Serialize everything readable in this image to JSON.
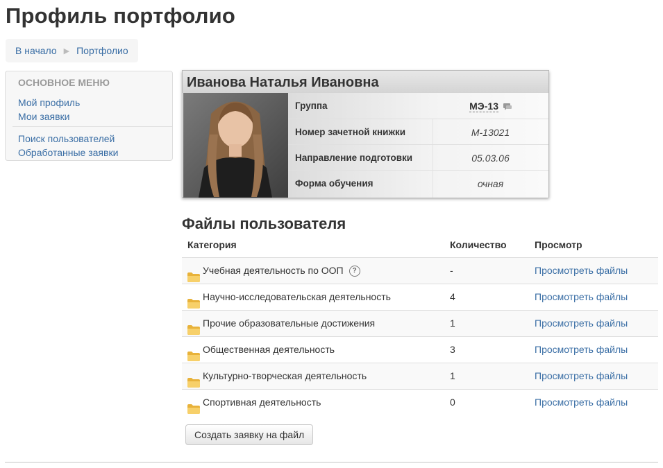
{
  "page": {
    "title": "Профиль портфолио"
  },
  "breadcrumb": {
    "items": [
      "В начало",
      "Портфолио"
    ]
  },
  "sidebar": {
    "heading": "ОСНОВНОЕ МЕНЮ",
    "links": [
      "Мой профиль",
      "Мои заявки",
      "Поиск пользователей",
      "Обработанные заявки"
    ]
  },
  "profile": {
    "name": "Иванова Наталья Ивановна",
    "fields": [
      {
        "label": "Группа",
        "value": "МЭ-13"
      },
      {
        "label": "Номер зачетной книжки",
        "value": "М-13021"
      },
      {
        "label": "Направление подготовки",
        "value": "05.03.06"
      },
      {
        "label": "Форма обучения",
        "value": "очная"
      }
    ]
  },
  "files": {
    "title": "Файлы пользователя",
    "headers": {
      "category": "Категория",
      "count": "Количество",
      "view": "Просмотр"
    },
    "rows": [
      {
        "category": "Учебная деятельность по ООП",
        "count": "-",
        "view": "Просмотреть файлы"
      },
      {
        "category": "Научно-исследовательская деятельность",
        "count": "4",
        "view": "Просмотреть файлы"
      },
      {
        "category": "Прочие образовательные достижения",
        "count": "1",
        "view": "Просмотреть файлы"
      },
      {
        "category": "Общественная деятельность",
        "count": "3",
        "view": "Просмотреть файлы"
      },
      {
        "category": "Культурно-творческая деятельность",
        "count": "1",
        "view": "Просмотреть файлы"
      },
      {
        "category": "Спортивная деятельность",
        "count": "0",
        "view": "Просмотреть файлы"
      }
    ]
  },
  "actions": {
    "create_request": "Создать заявку на файл"
  },
  "icons": {
    "folder": "folder-icon",
    "help": "help-icon",
    "chat": "chat-icon",
    "breadcrumb_sep": "triangle-right-icon"
  },
  "colors": {
    "link": "#3a6ea5",
    "folder": "#f3c74a"
  }
}
